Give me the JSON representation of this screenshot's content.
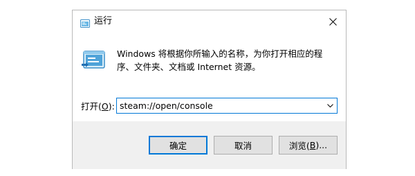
{
  "window": {
    "title": "运行",
    "close_symbol": "✕",
    "title_icon": "run-icon"
  },
  "content": {
    "icon": "run-program-icon",
    "description": "Windows 将根据你所输入的名称，为你打开相应的程序、文件夹、文档或 Internet 资源。",
    "open_label": "打开(O):",
    "open_label_prefix": "打开(",
    "open_label_mnemonic": "O",
    "open_label_suffix": "):",
    "input_value": "steam://open/console"
  },
  "buttons": {
    "ok": "确定",
    "cancel": "取消",
    "browse_prefix": "浏览(",
    "browse_mnemonic": "B",
    "browse_suffix": ")..."
  },
  "colors": {
    "accent": "#0078d7",
    "footer_bg": "#f0f0f0",
    "button_bg": "#e1e1e1",
    "icon_blue": "#4fa3d9"
  }
}
